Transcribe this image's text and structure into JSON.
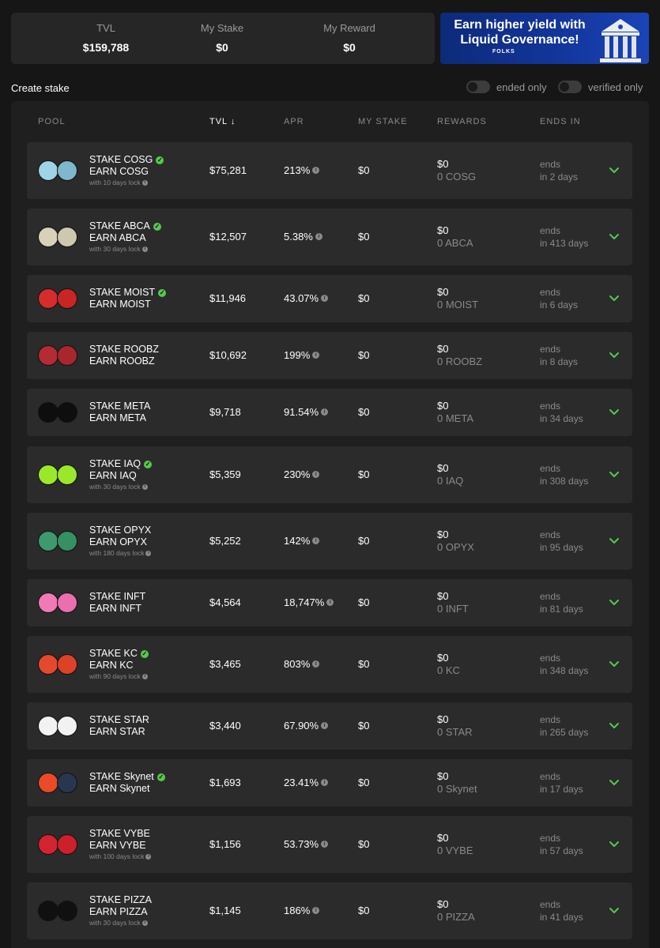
{
  "stats": [
    {
      "label": "TVL",
      "value": "$159,788"
    },
    {
      "label": "My Stake",
      "value": "$0"
    },
    {
      "label": "My Reward",
      "value": "$0"
    }
  ],
  "banner": {
    "line1": "Earn higher yield with",
    "line2": "Liquid Governance!",
    "brand": "FOLKS"
  },
  "controls": {
    "create": "Create stake",
    "ended": "ended only",
    "verified": "verified only"
  },
  "columns": [
    "POOL",
    "TVL",
    "APR",
    "MY STAKE",
    "REWARDS",
    "ENDS IN"
  ],
  "sort_indicator": "↓",
  "colors": {
    "accent": "#57c84d",
    "row_bg": "#2b2b2b",
    "panel_bg": "#1f1f1f",
    "page_bg": "#161616"
  },
  "pools": [
    {
      "stake": "STAKE COSG",
      "earn": "EARN COSG",
      "verified": true,
      "lock": "with 10 days lock",
      "tvl": "$75,281",
      "apr": "213%",
      "my_stake": "$0",
      "reward_usd": "$0",
      "reward_tok": "0 COSG",
      "ends": "ends",
      "ends_in": "in 2 days",
      "c1": "#9fd3e6",
      "c2": "#7fb7cc"
    },
    {
      "stake": "STAKE ABCA",
      "earn": "EARN ABCA",
      "verified": true,
      "lock": "with 30 days lock",
      "tvl": "$12,507",
      "apr": "5.38%",
      "my_stake": "$0",
      "reward_usd": "$0",
      "reward_tok": "0 ABCA",
      "ends": "ends",
      "ends_in": "in 413 days",
      "c1": "#d8d0b8",
      "c2": "#cfc8b0"
    },
    {
      "stake": "STAKE MOIST",
      "earn": "EARN MOIST",
      "verified": true,
      "lock": "",
      "tvl": "$11,946",
      "apr": "43.07%",
      "my_stake": "$0",
      "reward_usd": "$0",
      "reward_tok": "0 MOIST",
      "ends": "ends",
      "ends_in": "in 6 days",
      "c1": "#d62c2c",
      "c2": "#c92525"
    },
    {
      "stake": "STAKE ROOBZ",
      "earn": "EARN ROOBZ",
      "verified": false,
      "lock": "",
      "tvl": "$10,692",
      "apr": "199%",
      "my_stake": "$0",
      "reward_usd": "$0",
      "reward_tok": "0 ROOBZ",
      "ends": "ends",
      "ends_in": "in 8 days",
      "c1": "#b32b35",
      "c2": "#a9262e"
    },
    {
      "stake": "STAKE META",
      "earn": "EARN META",
      "verified": false,
      "lock": "",
      "tvl": "$9,718",
      "apr": "91.54%",
      "my_stake": "$0",
      "reward_usd": "$0",
      "reward_tok": "0 META",
      "ends": "ends",
      "ends_in": "in 34 days",
      "c1": "#0e0e0e",
      "c2": "#0e0e0e"
    },
    {
      "stake": "STAKE IAQ",
      "earn": "EARN IAQ",
      "verified": true,
      "lock": "with 30 days lock",
      "tvl": "$5,359",
      "apr": "230%",
      "my_stake": "$0",
      "reward_usd": "$0",
      "reward_tok": "0 IAQ",
      "ends": "ends",
      "ends_in": "in 308 days",
      "c1": "#9be82a",
      "c2": "#9be82a"
    },
    {
      "stake": "STAKE OPYX",
      "earn": "EARN OPYX",
      "verified": false,
      "lock": "with 180 days lock",
      "tvl": "$5,252",
      "apr": "142%",
      "my_stake": "$0",
      "reward_usd": "$0",
      "reward_tok": "0 OPYX",
      "ends": "ends",
      "ends_in": "in 95 days",
      "c1": "#3e9a6e",
      "c2": "#378f64"
    },
    {
      "stake": "STAKE INFT",
      "earn": "EARN INFT",
      "verified": false,
      "lock": "",
      "tvl": "$4,564",
      "apr": "18,747%",
      "my_stake": "$0",
      "reward_usd": "$0",
      "reward_tok": "0 INFT",
      "ends": "ends",
      "ends_in": "in 81 days",
      "c1": "#f07ab5",
      "c2": "#ea6fae"
    },
    {
      "stake": "STAKE KC",
      "earn": "EARN KC",
      "verified": true,
      "lock": "with 90 days lock",
      "tvl": "$3,465",
      "apr": "803%",
      "my_stake": "$0",
      "reward_usd": "$0",
      "reward_tok": "0 KC",
      "ends": "ends",
      "ends_in": "in 348 days",
      "c1": "#e4492b",
      "c2": "#dc4226"
    },
    {
      "stake": "STAKE STAR",
      "earn": "EARN STAR",
      "verified": false,
      "lock": "",
      "tvl": "$3,440",
      "apr": "67.90%",
      "my_stake": "$0",
      "reward_usd": "$0",
      "reward_tok": "0 STAR",
      "ends": "ends",
      "ends_in": "in 265 days",
      "c1": "#f2f2f2",
      "c2": "#f2f2f2"
    },
    {
      "stake": "STAKE Skynet",
      "earn": "EARN Skynet",
      "verified": true,
      "lock": "",
      "tvl": "$1,693",
      "apr": "23.41%",
      "my_stake": "$0",
      "reward_usd": "$0",
      "reward_tok": "0 Skynet",
      "ends": "ends",
      "ends_in": "in 17 days",
      "c1": "#e84a2a",
      "c2": "#2a3550"
    },
    {
      "stake": "STAKE VYBE",
      "earn": "EARN VYBE",
      "verified": false,
      "lock": "with 100 days lock",
      "tvl": "$1,156",
      "apr": "53.73%",
      "my_stake": "$0",
      "reward_usd": "$0",
      "reward_tok": "0 VYBE",
      "ends": "ends",
      "ends_in": "in 57 days",
      "c1": "#d22430",
      "c2": "#cc202c"
    },
    {
      "stake": "STAKE PIZZA",
      "earn": "EARN PIZZA",
      "verified": false,
      "lock": "with 30 days lock",
      "tvl": "$1,145",
      "apr": "186%",
      "my_stake": "$0",
      "reward_usd": "$0",
      "reward_tok": "0 PIZZA",
      "ends": "ends",
      "ends_in": "in 41 days",
      "c1": "#101010",
      "c2": "#101010"
    }
  ]
}
